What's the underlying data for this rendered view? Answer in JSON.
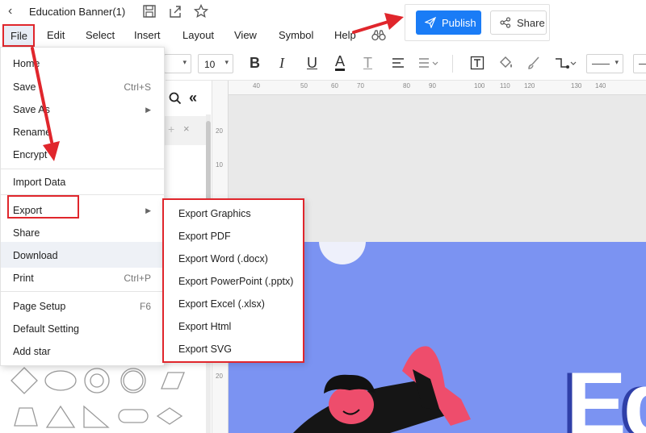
{
  "titlebar": {
    "title": "Education Banner(1)",
    "icons": [
      "back-icon",
      "save-icon",
      "export-icon",
      "star-icon"
    ]
  },
  "menubar": {
    "items": [
      "File",
      "Edit",
      "Select",
      "Insert",
      "Layout",
      "View",
      "Symbol",
      "Help"
    ]
  },
  "actions": {
    "publish_label": "Publish",
    "share_label": "Share"
  },
  "toolbar": {
    "font_size": "10",
    "bold": "B",
    "italic": "I",
    "underline": "U",
    "font_color": "A",
    "clear_format": "T"
  },
  "ruler": {
    "top": [
      "40",
      "50",
      "60",
      "70",
      "80",
      "90",
      "100",
      "110",
      "120",
      "130",
      "140"
    ],
    "left": [
      "20",
      "10",
      "20"
    ]
  },
  "file_menu": {
    "items": [
      {
        "label": "Home",
        "shortcut": ""
      },
      {
        "label": "Save",
        "shortcut": "Ctrl+S"
      },
      {
        "label": "Save As",
        "shortcut": ""
      },
      {
        "label": "Rename",
        "shortcut": ""
      },
      {
        "label": "Encrypt",
        "shortcut": ""
      },
      {
        "label": "Import Data",
        "shortcut": ""
      },
      {
        "label": "Export",
        "shortcut": ""
      },
      {
        "label": "Share",
        "shortcut": ""
      },
      {
        "label": "Download",
        "shortcut": ""
      },
      {
        "label": "Print",
        "shortcut": "Ctrl+P"
      },
      {
        "label": "Page Setup",
        "shortcut": "F6"
      },
      {
        "label": "Default Setting",
        "shortcut": ""
      },
      {
        "label": "Add star",
        "shortcut": ""
      }
    ]
  },
  "export_menu": {
    "items": [
      "Export Graphics",
      "Export PDF",
      "Export Word (.docx)",
      "Export PowerPoint (.pptx)",
      "Export Excel (.xlsx)",
      "Export Html",
      "Export SVG"
    ]
  },
  "banner": {
    "text": "Ed"
  },
  "colors": {
    "accent": "#1a7cf6",
    "highlight": "#e0262c",
    "banner_bg": "#7b93f2"
  }
}
